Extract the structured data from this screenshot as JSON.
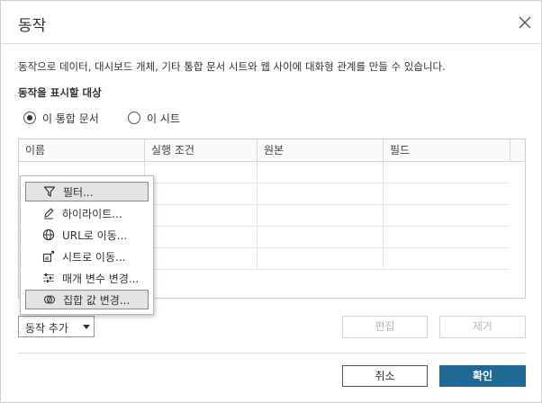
{
  "dialog": {
    "title": "동작",
    "description": "동작으로 데이터, 대시보드 개체, 기타 통합 문서 시트와 웹 사이에 대화형 관계를 만들 수 있습니다.",
    "section_label": "동작을 표시할 대상"
  },
  "scope": {
    "options": [
      {
        "label": "이 통합 문서",
        "selected": true
      },
      {
        "label": "이 시트",
        "selected": false
      }
    ]
  },
  "table": {
    "columns": [
      "이름",
      "실행 조건",
      "원본",
      "필드"
    ],
    "rows": []
  },
  "menu": {
    "items": [
      {
        "label": "필터...",
        "icon": "filter-icon",
        "highlighted": true
      },
      {
        "label": "하이라이트...",
        "icon": "highlight-pen-icon",
        "highlighted": false
      },
      {
        "label": "URL로 이동...",
        "icon": "globe-icon",
        "highlighted": false
      },
      {
        "label": "시트로 이동...",
        "icon": "go-to-sheet-icon",
        "highlighted": false
      },
      {
        "label": "매개 변수 변경...",
        "icon": "parameter-icon",
        "highlighted": false
      },
      {
        "label": "집합 값 변경...",
        "icon": "set-icon",
        "highlighted": true
      }
    ]
  },
  "buttons": {
    "add_action": "동작 추가",
    "edit": "편집",
    "remove": "제거",
    "cancel": "취소",
    "ok": "확인"
  },
  "colors": {
    "primary": "#1f6a94",
    "menu_highlight": "#e3e3e3"
  }
}
